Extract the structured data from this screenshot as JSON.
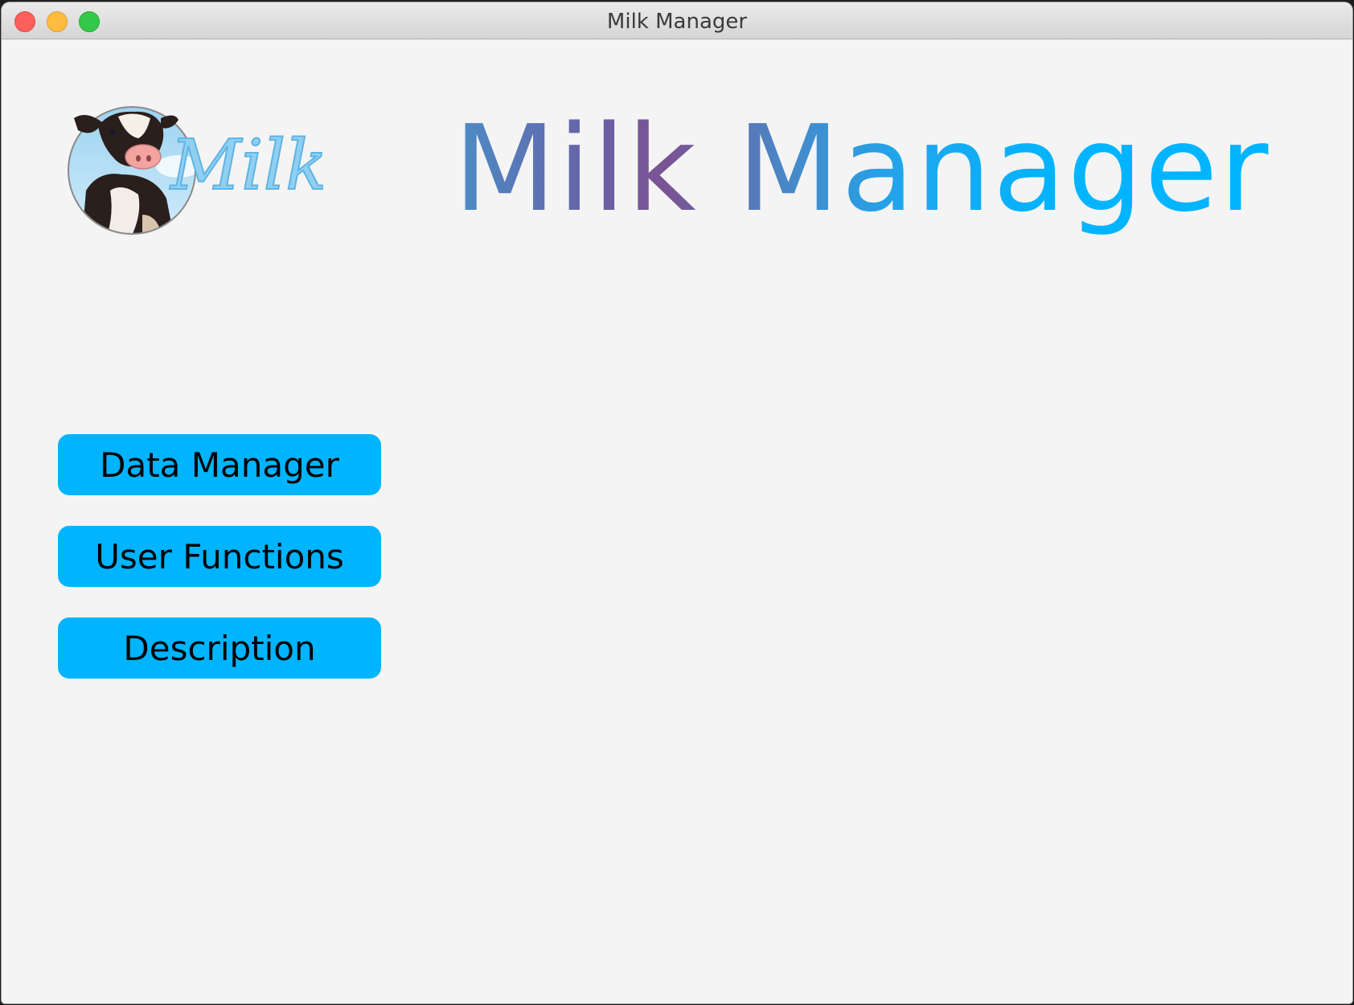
{
  "window": {
    "title": "Milk Manager"
  },
  "header": {
    "logo_icon": "cow-milk-logo",
    "title": "Milk Manager"
  },
  "menu": {
    "buttons": [
      {
        "label": "Data Manager"
      },
      {
        "label": "User Functions"
      },
      {
        "label": "Description"
      }
    ]
  },
  "colors": {
    "button_background": "#00b4ff",
    "accent_blue": "#00b4ff",
    "accent_purple": "#7b5293"
  }
}
